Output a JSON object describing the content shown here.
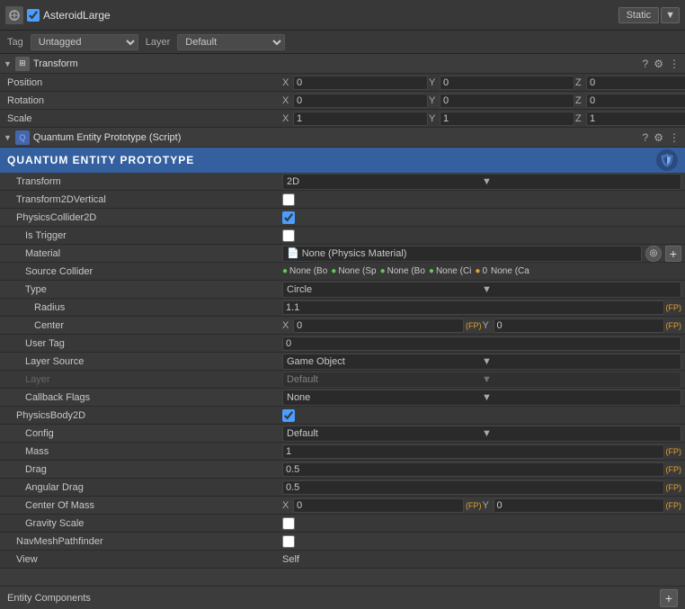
{
  "topbar": {
    "object_name": "AsteroidLarge",
    "static_label": "Static"
  },
  "tag_layer": {
    "tag_label": "Tag",
    "tag_value": "Untagged",
    "layer_label": "Layer",
    "layer_value": "Default"
  },
  "transform": {
    "header": "Transform",
    "position_label": "Position",
    "position_x": "0",
    "position_y": "0",
    "position_z": "0",
    "rotation_label": "Rotation",
    "rotation_x": "0",
    "rotation_y": "0",
    "rotation_z": "0",
    "scale_label": "Scale",
    "scale_x": "1",
    "scale_y": "1",
    "scale_z": "1"
  },
  "quantum_script": {
    "header": "Quantum Entity Prototype (Script)",
    "entity_label": "QUANTUM ENTITY PROTOTYPE",
    "transform_label": "Transform",
    "transform_value": "2D",
    "transform2d_vertical_label": "Transform2DVertical",
    "physics_collider_2d_label": "PhysicsCollider2D",
    "is_trigger_label": "Is Trigger",
    "material_label": "Material",
    "material_value": "None (Physics Material)",
    "source_collider_label": "Source Collider",
    "collider_badges": [
      {
        "dot": "green",
        "text": "None (Bo"
      },
      {
        "dot": "green",
        "text": "None (Sp"
      },
      {
        "dot": "green",
        "text": "None (Bo"
      },
      {
        "dot": "green",
        "text": "None (Ci"
      },
      {
        "dot": "orange",
        "text": "0"
      },
      {
        "dot": "none",
        "text": "None (Ca"
      }
    ],
    "type_label": "Type",
    "type_value": "Circle",
    "radius_label": "Radius",
    "radius_value": "1.1",
    "center_label": "Center",
    "center_x": "0",
    "center_y": "0",
    "user_tag_label": "User Tag",
    "user_tag_value": "0",
    "layer_source_label": "Layer Source",
    "layer_source_value": "Game Object",
    "layer_label": "Layer",
    "layer_value": "Default",
    "callback_flags_label": "Callback Flags",
    "callback_flags_value": "None",
    "physics_body_2d_label": "PhysicsBody2D",
    "config_label": "Config",
    "config_value": "Default",
    "mass_label": "Mass",
    "mass_value": "1",
    "drag_label": "Drag",
    "drag_value": "0.5",
    "angular_drag_label": "Angular Drag",
    "angular_drag_value": "0.5",
    "center_of_mass_label": "Center Of Mass",
    "center_of_mass_x": "0",
    "center_of_mass_y": "0",
    "gravity_scale_label": "Gravity Scale",
    "nav_mesh_pathfinder_label": "NavMeshPathfinder",
    "view_label": "View",
    "view_value": "Self"
  },
  "entity_components": {
    "label": "Entity Components",
    "plus_btn": "+"
  }
}
